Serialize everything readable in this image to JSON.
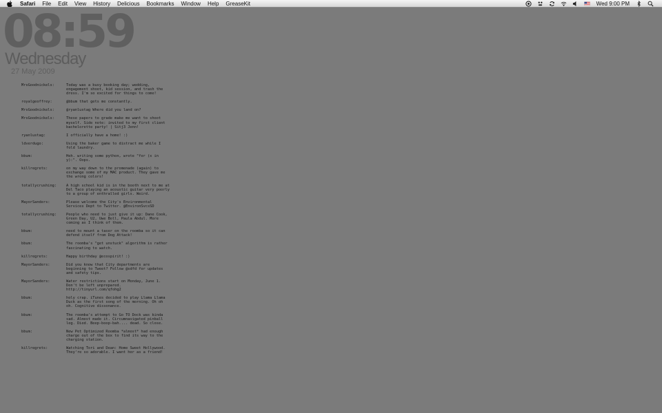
{
  "menubar": {
    "app_name": "Safari",
    "items": [
      "File",
      "Edit",
      "View",
      "History",
      "Delicious",
      "Bookmarks",
      "Window",
      "Help",
      "GreaseKit"
    ],
    "clock": "Wed 9:00 PM"
  },
  "icons": {
    "apple": "apple-icon",
    "status": [
      "camera-icon",
      "growl-icon",
      "sync-icon",
      "wifi-icon",
      "volume-icon",
      "flag-icon",
      "bluetooth-icon",
      "spotlight-icon"
    ]
  },
  "widget": {
    "time": "08:59",
    "weekday": "Wednesday",
    "date": "27 May 2009"
  },
  "tweets": [
    {
      "user": "MrsGoodnickels:",
      "text": "Today was a busy booking day; wedding, engagement shoot, kid session, and trash the dress. I'm so excited for things to come!"
    },
    {
      "user": "royalgeoffrey:",
      "text": "@bbum that gets me constantly."
    },
    {
      "user": "MrsGoodnickels:",
      "text": "@ryanlustag Where did you land on?"
    },
    {
      "user": "MrsGoodnickels:",
      "text": "These papers to grade make me want to shoot myself. Side note: invited to my first client bachelorette party! | Sitj3 Jenn!"
    },
    {
      "user": "ryanlustag:",
      "text": "I officially have a home! :)"
    },
    {
      "user": "ldverdugo:",
      "text": "Using the baker game to distract me while I fold laundry."
    },
    {
      "user": "bbum:",
      "text": "Heh.  writing some python, wrote \"for (x in y):\".  Oops."
    },
    {
      "user": "killregrets:",
      "text": "on my way down to the promenade (again) to exchange some of my MAC product. They gave me the wrong colors!"
    },
    {
      "user": "totallycrushing:",
      "text": "A high school kid is in the booth next to me at Del Taco playing an acoustic guitar very poorly to a group of enthralled girls. Weird."
    },
    {
      "user": "MayorSanders:",
      "text": "Please welcome the City's Environmental Services Dept to Twitter. @EnvironSvcsSD"
    },
    {
      "user": "totallycrushing:",
      "text": "People who need to just give it up: Dane Cook, Green Day, U2, Uwe Boll, Paula Abdul. More coming as I think of them."
    },
    {
      "user": "bbum:",
      "text": "need to mount a taser on the roomba so it can defend itself from Dog Attack!"
    },
    {
      "user": "bbum:",
      "text": "The roomba's \"get unstuck\" algorithm is rather fascinating to watch."
    },
    {
      "user": "killregrets:",
      "text": "Happy birthday @ecospirit! :)"
    },
    {
      "user": "MayorSanders:",
      "text": "Did you know that City departments are beginning to Tweet? Follow @sdfd for updates and safety tips."
    },
    {
      "user": "MayorSanders:",
      "text": "Water restrictions start on Monday, June 1. Don't be left unprepared. http://tinyurl.com/qfohg2"
    },
    {
      "user": "bbum:",
      "text": "holy crap.  iTunes decided to play Llama Llama Duck as the first song of the morning. Oh oh oh. Cognitive dissonance."
    },
    {
      "user": "bbum:",
      "text": "The roomba's attempt to Go TO Dock was kinda sad. Almost made it. Circumnavigated pinball leg. Died. Beep-boop-bah.... dead. So close."
    },
    {
      "user": "bbum:",
      "text": "New Pet Optimized Roomba *almost* had enough charge out of the box to find its way to the charging station."
    },
    {
      "user": "killregrets:",
      "text": "Watching Tori and Dean: Home Sweet Hollywood. They're so adorable. I want her as a friend!"
    }
  ]
}
